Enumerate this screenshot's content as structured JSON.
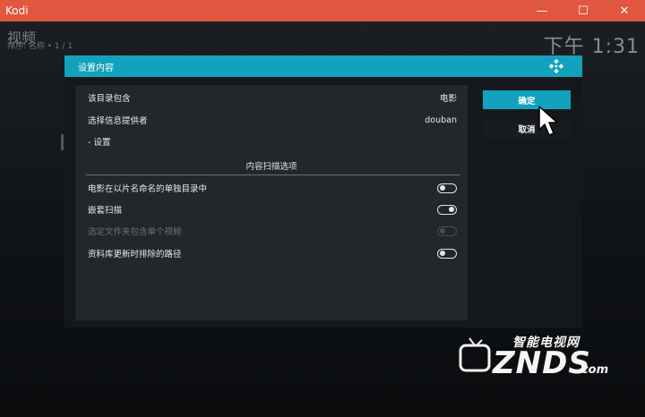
{
  "window": {
    "title": "Kodi",
    "minimize": "—",
    "maximize": "☐",
    "close": "✕"
  },
  "background": {
    "title": "视频",
    "sort": "排序: 名称 • 1 / 1",
    "clock": "下午 1:31"
  },
  "dialog": {
    "title": "设置内容",
    "rows": [
      {
        "label": "该目录包含",
        "value": "电影"
      },
      {
        "label": "选择信息提供者",
        "value": "douban"
      },
      {
        "label": "- 设置",
        "value": ""
      }
    ],
    "section_title": "内容扫描选项",
    "options": [
      {
        "label": "电影在以片名命名的单独目录中",
        "state": "off",
        "enabled": true
      },
      {
        "label": "嵌套扫描",
        "state": "on",
        "enabled": true
      },
      {
        "label": "选定文件夹包含单个视频",
        "state": "off",
        "enabled": false
      },
      {
        "label": "资料库更新时排除的路径",
        "state": "off",
        "enabled": true
      }
    ],
    "ok_label": "确定",
    "cancel_label": "取消"
  },
  "watermark": {
    "cn": "智能电视网",
    "brand": "ZNDS",
    "domain": ".com"
  },
  "colors": {
    "titlebar": "#e2573f",
    "accent": "#12a2bd",
    "panel": "#23272b"
  }
}
